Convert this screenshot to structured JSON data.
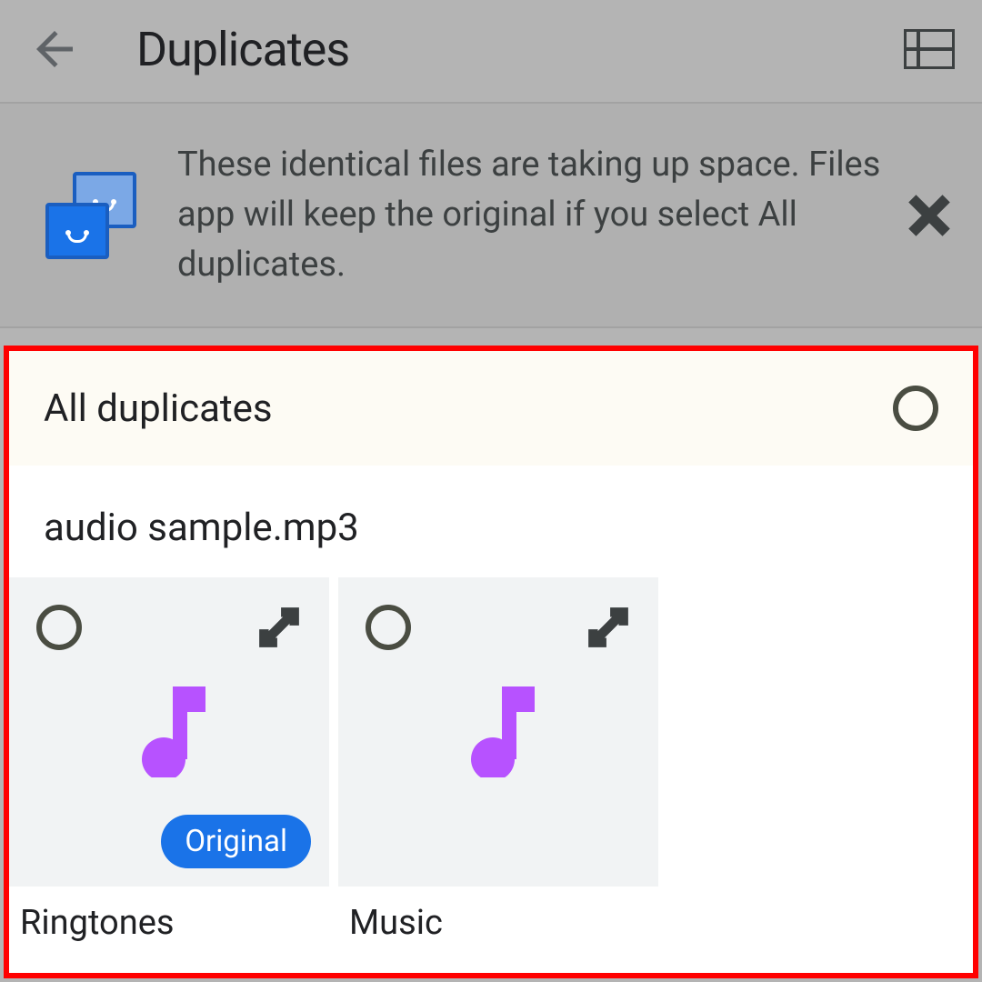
{
  "header": {
    "title": "Duplicates"
  },
  "banner": {
    "text": "These identical files are taking up space. Files app will keep the original if you select All duplicates."
  },
  "section": {
    "all_duplicates_label": "All duplicates",
    "filename": "audio sample.mp3"
  },
  "cards": [
    {
      "folder": "Ringtones",
      "badge": "Original"
    },
    {
      "folder": "Music",
      "badge": null
    }
  ]
}
